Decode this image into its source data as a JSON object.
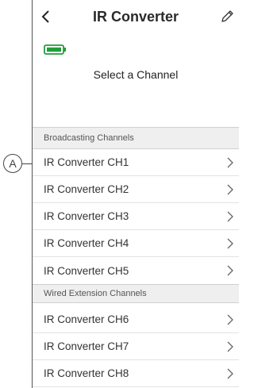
{
  "header": {
    "title": "IR Converter",
    "back_icon": "chevron-left-icon",
    "edit_icon": "pencil-icon"
  },
  "status": {
    "battery_icon": "battery-icon",
    "battery_color": "#1f9e3a",
    "prompt": "Select a Channel"
  },
  "sections": {
    "broadcasting": "Broadcasting Channels",
    "wired": "Wired Extension Channels"
  },
  "broadcasting_channels": [
    {
      "label": "IR Converter CH1"
    },
    {
      "label": "IR Converter CH2"
    },
    {
      "label": "IR Converter CH3"
    },
    {
      "label": "IR Converter CH4"
    },
    {
      "label": "IR Converter CH5"
    }
  ],
  "wired_channels": [
    {
      "label": "IR Converter CH6"
    },
    {
      "label": "IR Converter CH7"
    },
    {
      "label": "IR Converter CH8"
    }
  ],
  "annotation": {
    "callout_letter": "A"
  }
}
